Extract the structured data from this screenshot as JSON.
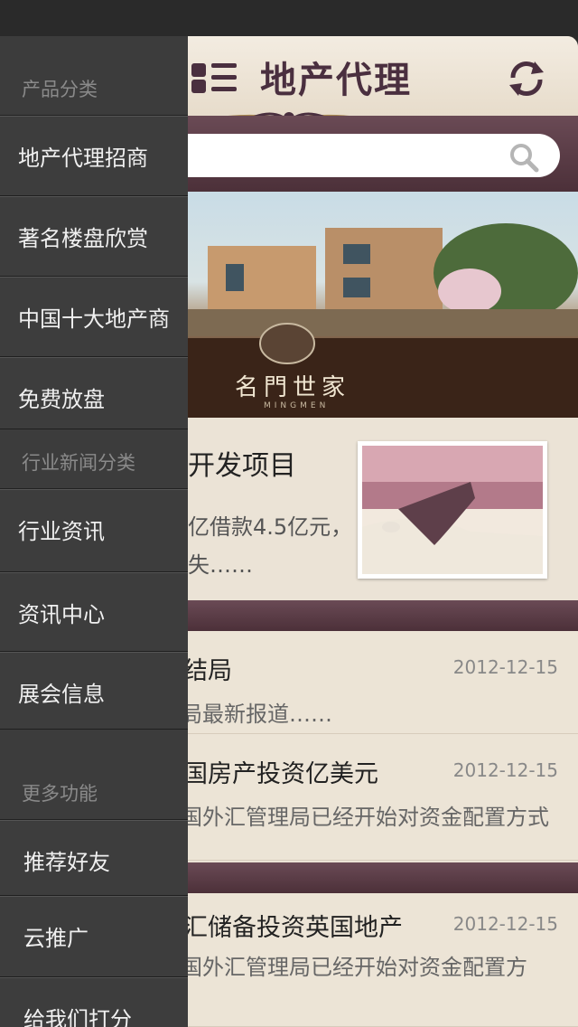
{
  "header": {
    "title": "地产代理"
  },
  "search": {
    "placeholder": ""
  },
  "banner": {
    "caption": "名門世家",
    "sub": "MINGMEN"
  },
  "feature": {
    "title": "开发项目",
    "desc_line1": "亿借款4.5亿元，",
    "desc_line2": "失……"
  },
  "news": [
    {
      "title": "盘结局",
      "date": "2012-12-15",
      "summary": "结局最新报道……"
    },
    {
      "title": "英国房产投资亿美元",
      "date": "2012-12-15",
      "summary": "中国外汇管理局已经开始对资金配置方式"
    },
    {
      "title": "外汇储备投资英国地产",
      "date": "2012-12-15",
      "summary": "中国外汇管理局已经开始对资金配置方"
    }
  ],
  "drawer": {
    "section1": "产品分类",
    "items1": [
      "地产代理招商",
      "著名楼盘欣赏",
      "中国十大地产商",
      "免费放盘"
    ],
    "section2": "行业新闻分类",
    "items2": [
      "行业资讯",
      "资讯中心",
      "展会信息"
    ],
    "section3": "更多功能",
    "items3": [
      "推荐好友",
      "云推广",
      "给我们打分"
    ]
  }
}
